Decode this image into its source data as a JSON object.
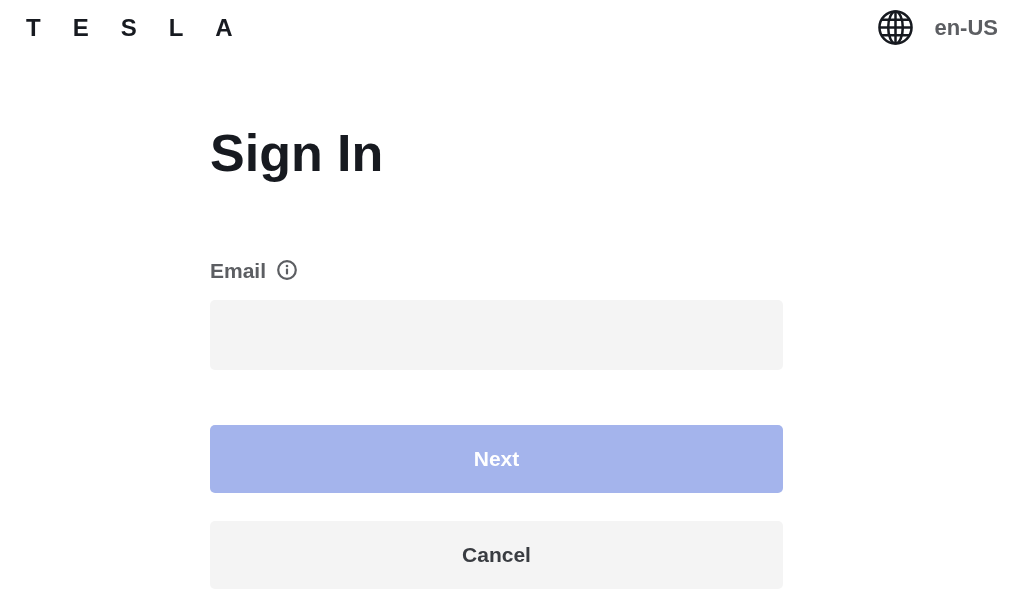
{
  "header": {
    "logo": "TESLA",
    "language": "en-US"
  },
  "form": {
    "title": "Sign In",
    "email": {
      "label": "Email"
    },
    "buttons": [
      {
        "label": "Next",
        "kind": "primary",
        "disabled": true
      },
      {
        "label": "Cancel",
        "kind": "secondary",
        "disabled": false
      }
    ]
  }
}
